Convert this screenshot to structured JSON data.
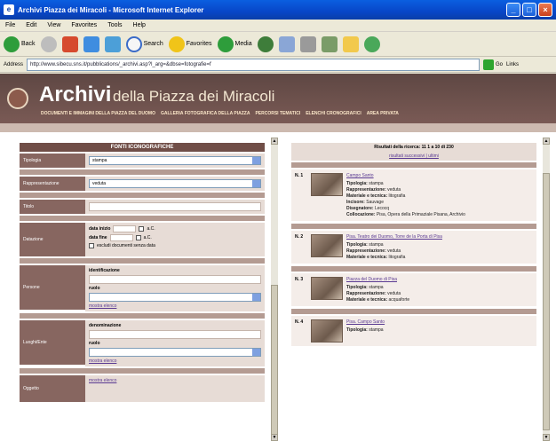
{
  "window": {
    "title": "Archivi Piazza dei Miracoli - Microsoft Internet Explorer",
    "controls": [
      "_",
      "□",
      "×"
    ]
  },
  "menu": [
    "File",
    "Edit",
    "View",
    "Favorites",
    "Tools",
    "Help"
  ],
  "toolbar": {
    "back_label": "Back",
    "search_label": "Search",
    "favorites_label": "Favorites",
    "media_label": "Media"
  },
  "address": {
    "label": "Address",
    "url": "http://www.sibecu.sns.it/pubblications/_archivi.asp?l_arg=&dbse=fotografie=f",
    "go_label": "Go",
    "links_label": "Links"
  },
  "banner": {
    "title_part1": "Archivi",
    "title_part2": "della Piazza dei Miracoli",
    "nav_links": [
      "DOCUMENTI E IMMAGINI DELLA PIAZZA DEL DUOMO",
      "GALLERIA FOTOGRAFICA DELLA PIAZZA",
      "PERCORSI TEMATICI",
      "ELENCHI CRONOGRAFICI",
      "AREA PRIVATA"
    ]
  },
  "form": {
    "heading": "FONTI ICONOGRAFICHE",
    "tipologia_label": "Tipologia",
    "tipologia_value": "stampa",
    "rappresentazione_label": "Rappresentazione",
    "rappresentazione_value": "veduta",
    "titolo_label": "Titolo",
    "datazione_label": "Datazione",
    "data_inizio_label": "data inizio",
    "data_fine_label": "data fine",
    "ac_label": "a.C.",
    "escludi_label": "escludi documenti senza data",
    "persone_label": "Persone",
    "identificazione_label": "identificazione",
    "ruolo_label": "ruolo",
    "mostra_label": "mostra elenco",
    "luoghi_label": "Luoghi/Ente",
    "denominazione_label": "denominazione",
    "oggetto_label": "Oggetto"
  },
  "results": {
    "heading": "Risultati della ricerca: 11 1 a 10 di 230",
    "sub_links": "risultati successivi | ultimi",
    "items": [
      {
        "num": "N. 1",
        "title": "Campo Santo",
        "meta": [
          [
            "Tipologia:",
            "stampa"
          ],
          [
            "Rappresentazione:",
            "veduta"
          ],
          [
            "Materiale e tecnica:",
            "litografia"
          ],
          [
            "Incisore:",
            "Sauvage"
          ],
          [
            "Disegnatore:",
            "Lecocq"
          ],
          [
            "Collocazione:",
            "Pisa, Opera della Primaziale Pisana, Archivio"
          ]
        ]
      },
      {
        "num": "N. 2",
        "title": "Pisa. Teatro dei Duomo, Torre de la Porta di Pisa",
        "meta": [
          [
            "Tipologia:",
            "stampa"
          ],
          [
            "Rappresentazione:",
            "veduta"
          ],
          [
            "Materiale e tecnica:",
            "litografia"
          ]
        ]
      },
      {
        "num": "N. 3",
        "title": "Piazza del Duomo di Pisa",
        "meta": [
          [
            "Tipologia:",
            "stampa"
          ],
          [
            "Rappresentazione:",
            "veduta"
          ],
          [
            "Materiale e tecnica:",
            "acquaforte"
          ]
        ]
      },
      {
        "num": "N. 4",
        "title": "Pisa. Campo Santo",
        "meta": [
          [
            "Tipologia:",
            "stampa"
          ]
        ]
      }
    ]
  }
}
